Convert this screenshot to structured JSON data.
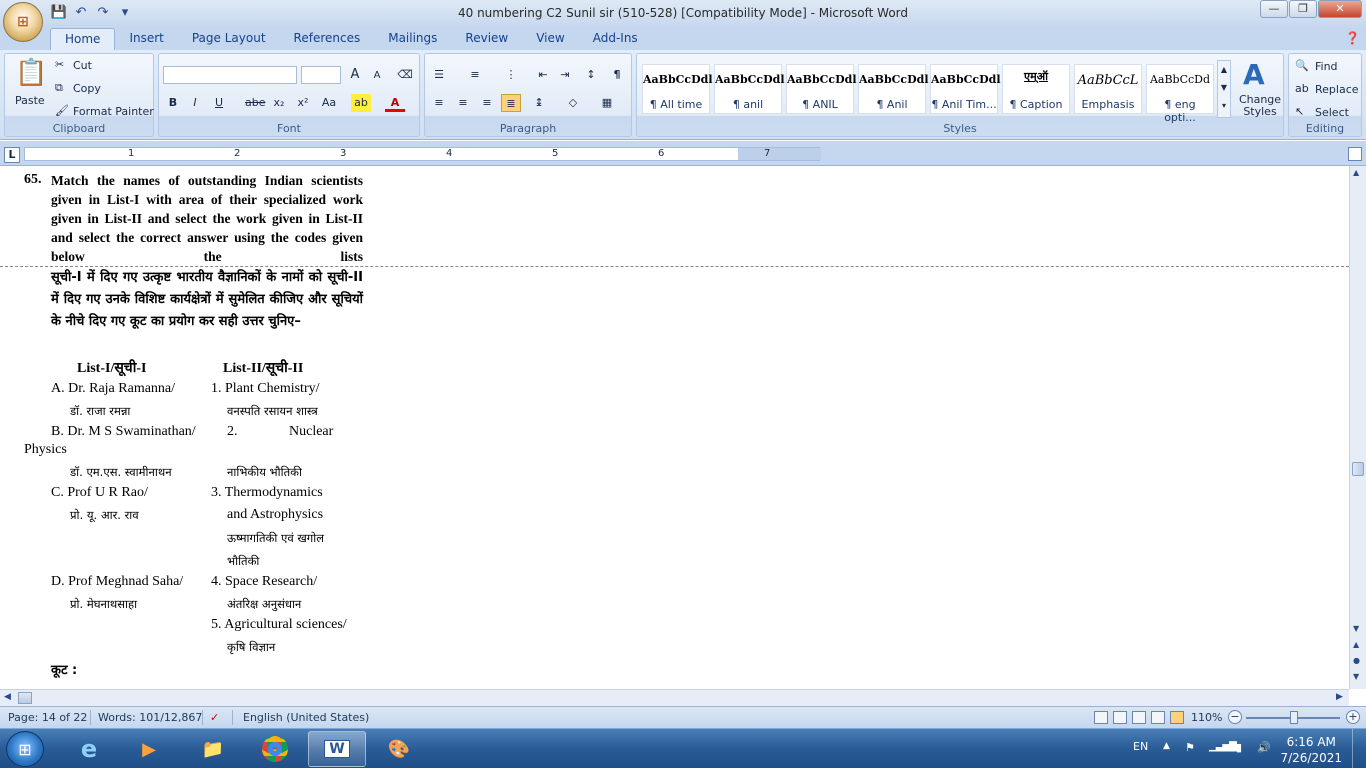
{
  "window": {
    "title": "40 numbering C2 Sunil sir (510-528) [Compatibility Mode] - Microsoft Word"
  },
  "tabs": [
    "Home",
    "Insert",
    "Page Layout",
    "References",
    "Mailings",
    "Review",
    "View",
    "Add-Ins"
  ],
  "clipboard": {
    "paste": "Paste",
    "cut": "Cut",
    "copy": "Copy",
    "format_painter": "Format Painter",
    "label": "Clipboard"
  },
  "font": {
    "label": "Font",
    "bold": "B",
    "italic": "I",
    "underline": "U",
    "strike": "abe",
    "sub": "x₂",
    "sup": "x²",
    "case": "Aa",
    "grow": "A",
    "shrink": "A",
    "font_color": "A"
  },
  "paragraph": {
    "label": "Paragraph",
    "pilcrow": "¶"
  },
  "styles": {
    "label": "Styles",
    "items": [
      {
        "sample": "AaBbCcDdl",
        "name": "¶ All time"
      },
      {
        "sample": "AaBbCcDdl",
        "name": "¶ anil"
      },
      {
        "sample": "AaBbCcDdl",
        "name": "¶ ANIL"
      },
      {
        "sample": "AaBbCcDdl",
        "name": "¶ Anil"
      },
      {
        "sample": "AaBbCcDdl",
        "name": "¶ Anil Tim..."
      },
      {
        "sample": "एम्ऑ",
        "name": "¶ Caption"
      },
      {
        "sample": "AaBbCcL",
        "name": "Emphasis"
      },
      {
        "sample": "AaBbCcDd",
        "name": "¶ eng opti..."
      }
    ],
    "change_styles": "Change Styles"
  },
  "editing": {
    "label": "Editing",
    "find": "Find",
    "replace": "Replace",
    "select": "Select"
  },
  "ruler": {
    "corner": "L",
    "numbers": [
      "1",
      "2",
      "3",
      "4",
      "5",
      "6",
      "7"
    ]
  },
  "document": {
    "question_number": "65.",
    "question_en": "Match the names of outstanding Indian scientists given in List-I with area of their specialized work given in List-II and select the work given in List-II and select the correct answer using the codes given below the lists",
    "question_hi": "सूची-I में दिए गए उत्कृष्ट भारतीय वैज्ञानिकों के नामों को सूची-II में दिए गए उनके विशिष्ट कार्यक्षेत्रों में सुमेलित कीजिए और सूचियों के नीचे दिए गए कूट का प्रयोग कर सही उत्तर चुनिए–",
    "list1_header": "List-I/सूची-I",
    "list2_header": "List-II/सूची-II",
    "a_en": "A. Dr. Raja Ramanna/",
    "a_hi": "डॉ. राजा रमन्ना",
    "b_en": "B. Dr. M S Swaminathan/",
    "b_hi": "डॉ. एम.एस. स्वामीनाथन",
    "c_en": "C. Prof U R Rao/",
    "c_hi": "प्रो. यू. आर. राव",
    "d_en": "D. Prof Meghnad Saha/",
    "d_hi": "प्रो. मेघनाथसाहा",
    "o1_en": "1. Plant Chemistry/",
    "o1_hi": "वनस्पति रसायन शास्त्र",
    "o2_a": "2.",
    "o2_b": "Nuclear",
    "o2_c": "Physics",
    "o2_hi": "नाभिकीय भौतिकी",
    "o3_en": "3. Thermodynamics",
    "o3_en2": "and Astrophysics",
    "o3_hi": "ऊष्मागतिकी एवं खगोल",
    "o3_hi2": "भौतिकी",
    "o4_en": "4. Space Research/",
    "o4_hi": "अंतरिक्ष अनुसंधान",
    "o5_en": "5. Agricultural sciences/",
    "o5_hi": "कृषि विज्ञान",
    "codes": "कूट :"
  },
  "status": {
    "page": "Page: 14 of 22",
    "words": "Words: 101/12,867",
    "language": "English (United States)",
    "zoom": "110%"
  },
  "taskbar": {
    "lang": "EN",
    "time": "6:16 AM",
    "date": "7/26/2021"
  }
}
